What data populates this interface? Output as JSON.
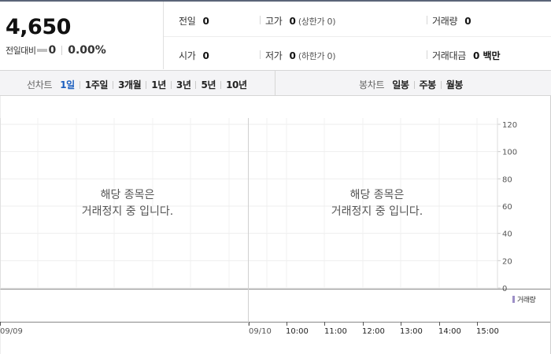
{
  "quote": {
    "price": "4,650",
    "change_label": "전일대비",
    "change_value": "0",
    "change_rate": "0.00%",
    "flat_color": "#bfbfbf"
  },
  "stats": {
    "prev_close": {
      "label": "전일",
      "value": "0"
    },
    "high": {
      "label": "고가",
      "value": "0",
      "limit": "(상한가 0)"
    },
    "volume": {
      "label": "거래량",
      "value": "0"
    },
    "open": {
      "label": "시가",
      "value": "0"
    },
    "low": {
      "label": "저가",
      "value": "0",
      "limit": "(하한가 0)"
    },
    "amount": {
      "label": "거래대금",
      "value": "0 백만"
    }
  },
  "line_chart_tabs": {
    "label": "선차트",
    "items": [
      "1일",
      "1주일",
      "3개월",
      "1년",
      "3년",
      "5년",
      "10년"
    ],
    "active_index": 0
  },
  "candle_chart_tabs": {
    "label": "봉차트",
    "items": [
      "일봉",
      "주봉",
      "월봉"
    ]
  },
  "chart": {
    "halt_message_line1": "해당 종목은",
    "halt_message_line2": "거래정지 중 입니다.",
    "y_ticks": [
      "120",
      "100",
      "80",
      "60",
      "40",
      "20",
      "0"
    ],
    "volume_legend": "거래량",
    "volume_color": "#9d8fc7",
    "active_color": "#1c5fbf",
    "x_labels": [
      "09/09",
      "09/10",
      "10:00",
      "11:00",
      "12:00",
      "13:00",
      "14:00",
      "15:00"
    ]
  }
}
